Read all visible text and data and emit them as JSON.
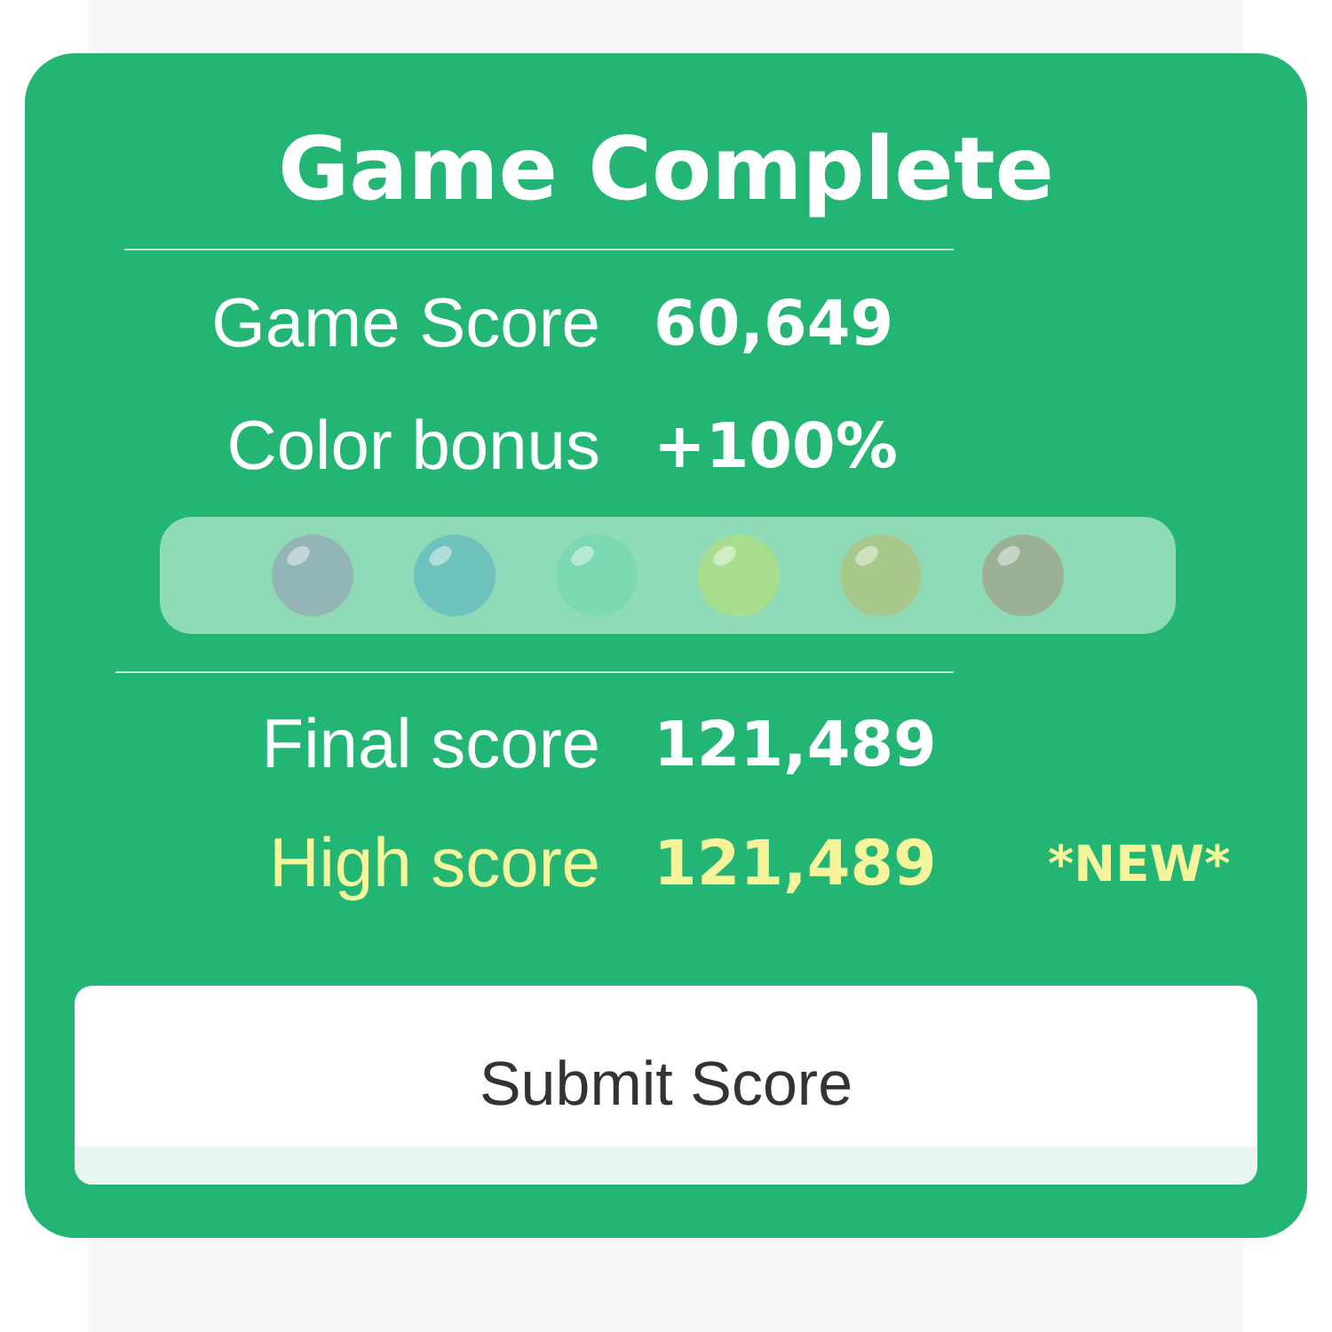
{
  "title": "Game Complete",
  "summary": [
    {
      "label": "Game Score",
      "value": "60,649"
    },
    {
      "label": "Color bonus",
      "value": "+100%"
    }
  ],
  "color_balls": [
    {
      "color": "#93b5b5"
    },
    {
      "color": "#6fc3bf"
    },
    {
      "color": "#7dd9b2"
    },
    {
      "color": "#a9de8f"
    },
    {
      "color": "#a8c98b"
    },
    {
      "color": "#9cb095"
    }
  ],
  "results": [
    {
      "label": "Final score",
      "value": "121,489",
      "highlighted": false
    },
    {
      "label": "High score",
      "value": "121,489",
      "highlighted": true,
      "badge": "*NEW*"
    }
  ],
  "submit_button": {
    "label": "Submit Score"
  }
}
